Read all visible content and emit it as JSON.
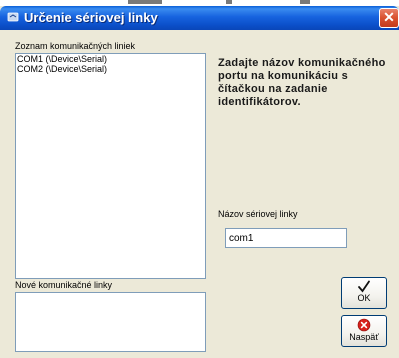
{
  "window": {
    "title": "Určenie sériovej linky",
    "close_glyph": "✕"
  },
  "lists": {
    "ports_label": "Zoznam komunikačných liniek",
    "ports": [
      "COM1 (\\Device\\Serial)",
      "COM2 (\\Device\\Serial)"
    ],
    "new_label": "Nové komunikačné linky",
    "new_lines": []
  },
  "instruction": "Zadajte názov komunikačného portu na komunikáciu s čítačkou na zadanie identifikátorov.",
  "serial_name": {
    "label": "Názov sériovej linky",
    "value": "com1"
  },
  "buttons": {
    "ok_label": "OK",
    "back_label": "Naspäť"
  },
  "icons": {
    "title": "window-app-icon",
    "ok": "checkmark-icon",
    "back": "red-x-circle-icon"
  },
  "colors": {
    "titlebar": "#0b4fc9",
    "window_bg": "#ece9d8",
    "close": "#d9512f",
    "back_icon": "#d8201c"
  }
}
